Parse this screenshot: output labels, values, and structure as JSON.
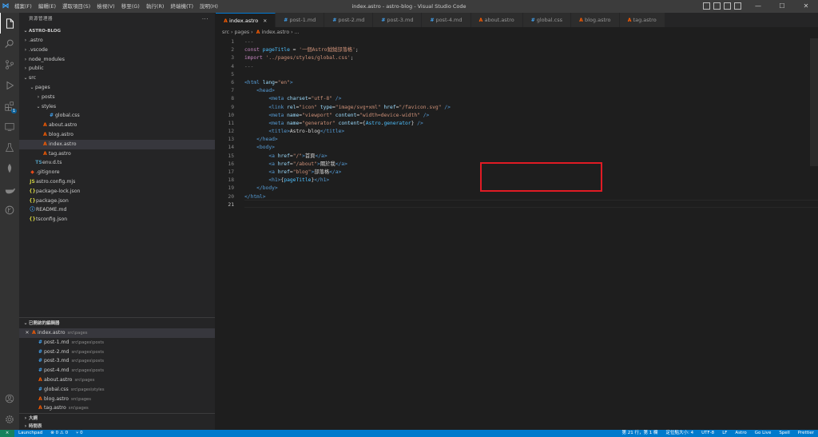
{
  "window": {
    "title": "index.astro - astro-blog - Visual Studio Code",
    "menus": [
      "檔案(F)",
      "編輯(E)",
      "選取項目(S)",
      "檢視(V)",
      "移至(G)",
      "執行(R)",
      "終端機(T)",
      "說明(H)"
    ],
    "minimize": "—",
    "maximize": "☐",
    "close": "✕"
  },
  "activity": {
    "scm_badge": "1"
  },
  "sidebar": {
    "title": "資源管理器",
    "more": "···",
    "root": "ASTRO-BLOG",
    "tree": [
      {
        "label": ".astro",
        "depth": 0,
        "chev": "›",
        "icon": ""
      },
      {
        "label": ".vscode",
        "depth": 0,
        "chev": "›",
        "icon": ""
      },
      {
        "label": "node_modules",
        "depth": 0,
        "chev": "›",
        "icon": ""
      },
      {
        "label": "public",
        "depth": 0,
        "chev": "›",
        "icon": ""
      },
      {
        "label": "src",
        "depth": 0,
        "chev": "⌄",
        "icon": ""
      },
      {
        "label": "pages",
        "depth": 1,
        "chev": "⌄",
        "icon": ""
      },
      {
        "label": "posts",
        "depth": 2,
        "chev": "›",
        "icon": ""
      },
      {
        "label": "styles",
        "depth": 2,
        "chev": "⌄",
        "icon": ""
      },
      {
        "label": "global.css",
        "depth": 3,
        "chev": "",
        "icon": "#",
        "kind": "css"
      },
      {
        "label": "about.astro",
        "depth": 2,
        "chev": "",
        "icon": "A",
        "kind": "astro"
      },
      {
        "label": "blog.astro",
        "depth": 2,
        "chev": "",
        "icon": "A",
        "kind": "astro"
      },
      {
        "label": "index.astro",
        "depth": 2,
        "chev": "",
        "icon": "A",
        "kind": "astro",
        "selected": true
      },
      {
        "label": "tag.astro",
        "depth": 2,
        "chev": "",
        "icon": "A",
        "kind": "astro"
      },
      {
        "label": "env.d.ts",
        "depth": 1,
        "chev": "",
        "icon": "TS",
        "kind": "ts"
      },
      {
        "label": ".gitignore",
        "depth": 0,
        "chev": "",
        "icon": "◆",
        "kind": "git"
      },
      {
        "label": "astro.config.mjs",
        "depth": 0,
        "chev": "",
        "icon": "JS",
        "kind": "mjs"
      },
      {
        "label": "package-lock.json",
        "depth": 0,
        "chev": "",
        "icon": "{}",
        "kind": "json"
      },
      {
        "label": "package.json",
        "depth": 0,
        "chev": "",
        "icon": "{}",
        "kind": "json"
      },
      {
        "label": "README.md",
        "depth": 0,
        "chev": "",
        "icon": "ⓘ",
        "kind": "info"
      },
      {
        "label": "tsconfig.json",
        "depth": 0,
        "chev": "",
        "icon": "{}",
        "kind": "json"
      }
    ],
    "open_editors_title": "已開啟的編輯器",
    "open_editors": [
      {
        "label": "index.astro",
        "path": "src\\pages",
        "icon": "A",
        "kind": "astro",
        "selected": true
      },
      {
        "label": "post-1.md",
        "path": "src\\pages\\posts",
        "icon": "#",
        "kind": "md"
      },
      {
        "label": "post-2.md",
        "path": "src\\pages\\posts",
        "icon": "#",
        "kind": "md"
      },
      {
        "label": "post-3.md",
        "path": "src\\pages\\posts",
        "icon": "#",
        "kind": "md"
      },
      {
        "label": "post-4.md",
        "path": "src\\pages\\posts",
        "icon": "#",
        "kind": "md"
      },
      {
        "label": "about.astro",
        "path": "src\\pages",
        "icon": "A",
        "kind": "astro"
      },
      {
        "label": "global.css",
        "path": "src\\pages\\styles",
        "icon": "#",
        "kind": "css"
      },
      {
        "label": "blog.astro",
        "path": "src\\pages",
        "icon": "A",
        "kind": "astro"
      },
      {
        "label": "tag.astro",
        "path": "src\\pages",
        "icon": "A",
        "kind": "astro"
      }
    ],
    "outline_title": "大綱",
    "timeline_title": "時間表"
  },
  "tabs": [
    {
      "label": "index.astro",
      "icon": "A",
      "kind": "astro",
      "active": true
    },
    {
      "label": "post-1.md",
      "icon": "#",
      "kind": "md"
    },
    {
      "label": "post-2.md",
      "icon": "#",
      "kind": "md"
    },
    {
      "label": "post-3.md",
      "icon": "#",
      "kind": "md"
    },
    {
      "label": "post-4.md",
      "icon": "#",
      "kind": "md"
    },
    {
      "label": "about.astro",
      "icon": "A",
      "kind": "astro"
    },
    {
      "label": "global.css",
      "icon": "#",
      "kind": "css"
    },
    {
      "label": "blog.astro",
      "icon": "A",
      "kind": "astro"
    },
    {
      "label": "tag.astro",
      "icon": "A",
      "kind": "astro"
    }
  ],
  "breadcrumb": [
    "src",
    "pages",
    "index.astro",
    "..."
  ],
  "code": [
    [
      [
        "fm",
        "---"
      ]
    ],
    [
      [
        "kw",
        "const "
      ],
      [
        "var",
        "pageTitle"
      ],
      [
        "def",
        " = "
      ],
      [
        "str",
        "'一個Astro鉞鉞部落格'"
      ],
      [
        "def",
        ";"
      ]
    ],
    [
      [
        "kw",
        "import "
      ],
      [
        "str",
        "'../pages/styles/global.css'"
      ],
      [
        "def",
        ";"
      ]
    ],
    [
      [
        "fm",
        "---"
      ]
    ],
    [],
    [
      [
        "tag",
        "<html "
      ],
      [
        "attr",
        "lang"
      ],
      [
        "def",
        "="
      ],
      [
        "str",
        "\"en\""
      ],
      [
        "tag",
        ">"
      ]
    ],
    [
      [
        "def",
        "    "
      ],
      [
        "tag",
        "<head>"
      ]
    ],
    [
      [
        "def",
        "        "
      ],
      [
        "tag",
        "<meta "
      ],
      [
        "attr",
        "charset"
      ],
      [
        "def",
        "="
      ],
      [
        "str",
        "\"utf-8\""
      ],
      [
        "tag",
        " />"
      ]
    ],
    [
      [
        "def",
        "        "
      ],
      [
        "tag",
        "<link "
      ],
      [
        "attr",
        "rel"
      ],
      [
        "def",
        "="
      ],
      [
        "str",
        "\"icon\""
      ],
      [
        "def",
        " "
      ],
      [
        "attr",
        "type"
      ],
      [
        "def",
        "="
      ],
      [
        "str",
        "\"image/svg+xml\""
      ],
      [
        "def",
        " "
      ],
      [
        "attr",
        "href"
      ],
      [
        "def",
        "="
      ],
      [
        "str",
        "\"/favicon.svg\""
      ],
      [
        "tag",
        " />"
      ]
    ],
    [
      [
        "def",
        "        "
      ],
      [
        "tag",
        "<meta "
      ],
      [
        "attr",
        "name"
      ],
      [
        "def",
        "="
      ],
      [
        "str",
        "\"viewport\""
      ],
      [
        "def",
        " "
      ],
      [
        "attr",
        "content"
      ],
      [
        "def",
        "="
      ],
      [
        "str",
        "\"width=device-width\""
      ],
      [
        "tag",
        " />"
      ]
    ],
    [
      [
        "def",
        "        "
      ],
      [
        "tag",
        "<meta "
      ],
      [
        "attr",
        "name"
      ],
      [
        "def",
        "="
      ],
      [
        "str",
        "\"generator\""
      ],
      [
        "def",
        " "
      ],
      [
        "attr",
        "content"
      ],
      [
        "def",
        "={"
      ],
      [
        "var",
        "Astro"
      ],
      [
        "def",
        "."
      ],
      [
        "var",
        "generator"
      ],
      [
        "def",
        "}"
      ],
      [
        "tag",
        " />"
      ]
    ],
    [
      [
        "def",
        "        "
      ],
      [
        "tag",
        "<title>"
      ],
      [
        "def",
        "Astro-blog"
      ],
      [
        "tag",
        "</title>"
      ]
    ],
    [
      [
        "def",
        "    "
      ],
      [
        "tag",
        "</head>"
      ]
    ],
    [
      [
        "def",
        "    "
      ],
      [
        "tag",
        "<body>"
      ]
    ],
    [
      [
        "def",
        "        "
      ],
      [
        "tag",
        "<a "
      ],
      [
        "attr",
        "href"
      ],
      [
        "def",
        "="
      ],
      [
        "str",
        "\"/\""
      ],
      [
        "tag",
        ">"
      ],
      [
        "def",
        "首頁"
      ],
      [
        "tag",
        "</a>"
      ]
    ],
    [
      [
        "def",
        "        "
      ],
      [
        "tag",
        "<a "
      ],
      [
        "attr",
        "href"
      ],
      [
        "def",
        "="
      ],
      [
        "str",
        "\"/about\""
      ],
      [
        "tag",
        ">"
      ],
      [
        "def",
        "關於我"
      ],
      [
        "tag",
        "</a>"
      ]
    ],
    [
      [
        "def",
        "        "
      ],
      [
        "tag",
        "<a "
      ],
      [
        "attr",
        "href"
      ],
      [
        "def",
        "="
      ],
      [
        "str",
        "\"blog\""
      ],
      [
        "tag",
        ">"
      ],
      [
        "def",
        "部落格"
      ],
      [
        "tag",
        "</a>"
      ]
    ],
    [
      [
        "def",
        "        "
      ],
      [
        "tag",
        "<h1>"
      ],
      [
        "def",
        "{"
      ],
      [
        "var",
        "pageTitle"
      ],
      [
        "def",
        "}"
      ],
      [
        "tag",
        "</h1>"
      ]
    ],
    [
      [
        "def",
        "    "
      ],
      [
        "tag",
        "</body>"
      ]
    ],
    [
      [
        "tag",
        "</html>"
      ]
    ],
    []
  ],
  "status": {
    "remote": "⨯",
    "launchpad": "Launchpad",
    "problems": "⊗ 0 ⚠ 0",
    "ports": "⑂ 0",
    "position": "第 21 行，第 1 欄",
    "indent": "定位點大小: 4",
    "encoding": "UTF-8",
    "eol": "LF",
    "language": "Astro",
    "golive": "Go Live",
    "spell": "Spell",
    "prettier": "Prettier"
  },
  "colors": {
    "accent": "#007acc",
    "highlight_box": "#e01b24"
  }
}
